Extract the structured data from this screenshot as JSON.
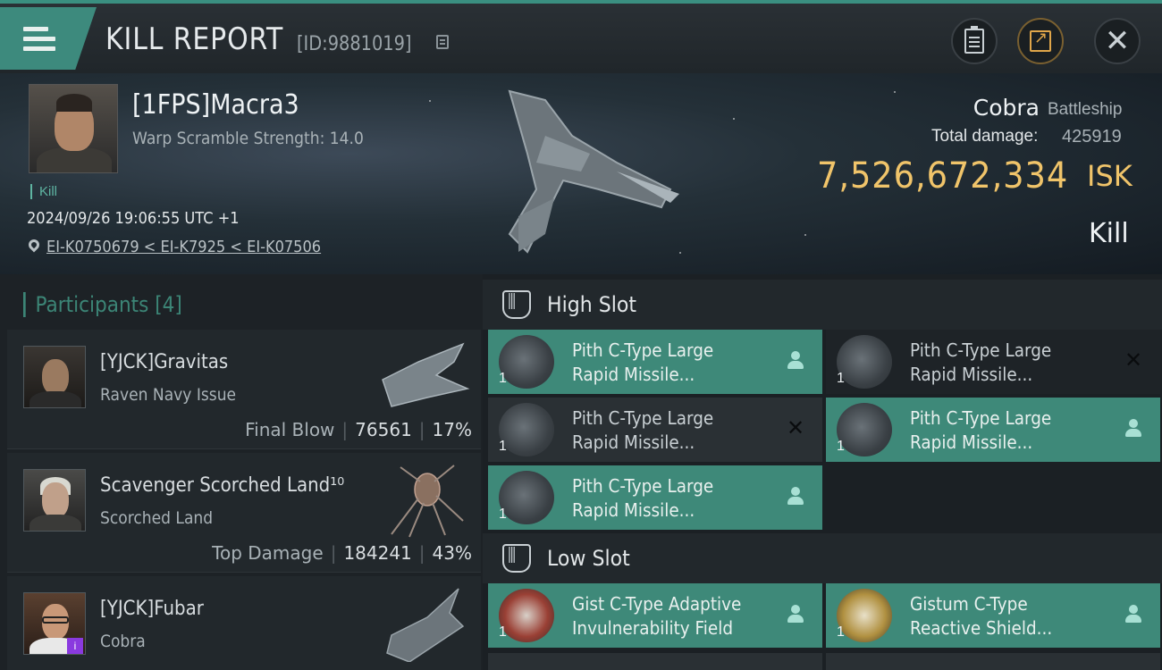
{
  "header": {
    "title": "KILL REPORT",
    "report_id": "[ID:9881019]",
    "icons": {
      "menu": "menu-icon",
      "copy": "copy-icon",
      "clipboard": "clipboard-icon",
      "share": "share-icon",
      "close": "close-icon"
    }
  },
  "victim": {
    "pilot": "[1FPS]Macra3",
    "warp_scramble": "Warp Scramble Strength: 14.0",
    "tag": "Kill",
    "datetime": "2024/09/26 19:06:55 UTC +1",
    "location": "EI-K0750679 < EI-K7925 < EI-K07506",
    "ship_name": "Cobra",
    "ship_class": "Battleship",
    "total_damage_label": "Total damage:",
    "total_damage": "425919",
    "isk_value": "7,526,672,334",
    "isk_unit": "ISK",
    "result": "Kill"
  },
  "participants": {
    "title": "Participants [4]",
    "items": [
      {
        "name": "[YJCK]Gravitas",
        "ship": "Raven Navy Issue",
        "role": "Final Blow",
        "damage": "76561",
        "percent": "17%"
      },
      {
        "name": "Scavenger Scorched Land¹⁰",
        "ship": "Scorched Land",
        "role": "Top Damage",
        "damage": "184241",
        "percent": "43%"
      },
      {
        "name": "[YJCK]Fubar",
        "ship": "Cobra",
        "role": "",
        "damage": "",
        "percent": ""
      }
    ]
  },
  "slots": {
    "high": {
      "title": "High Slot",
      "modules": [
        {
          "line1": "Pith C-Type Large",
          "line2": "Rapid Missile...",
          "count": "1",
          "status": "person-icon"
        },
        {
          "line1": "Pith C-Type Large",
          "line2": "Rapid Missile...",
          "count": "1",
          "status": "x-icon"
        },
        {
          "line1": "Pith C-Type Large",
          "line2": "Rapid Missile...",
          "count": "1",
          "status": "x-icon"
        },
        {
          "line1": "Pith C-Type Large",
          "line2": "Rapid Missile...",
          "count": "1",
          "status": "person-icon"
        },
        {
          "line1": "Pith C-Type Large",
          "line2": "Rapid Missile...",
          "count": "1",
          "status": "person-icon"
        }
      ]
    },
    "low": {
      "title": "Low Slot",
      "modules": [
        {
          "line1": "Gist C-Type Adaptive",
          "line2": "Invulnerability Field",
          "count": "1",
          "status": "person-icon"
        },
        {
          "line1": "Gistum C-Type",
          "line2": "Reactive Shield...",
          "count": "1",
          "status": "person-icon"
        }
      ]
    }
  },
  "colors": {
    "accent": "#3e8979",
    "isk": "#f0c46a",
    "panel": "#22282c"
  }
}
